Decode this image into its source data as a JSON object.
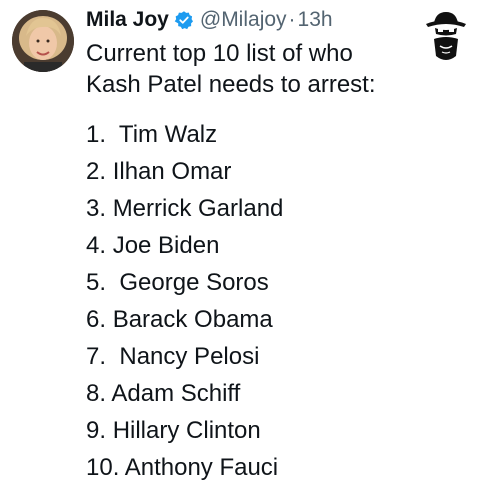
{
  "tweet": {
    "display_name": "Mila Joy",
    "handle": "@Milajoy",
    "separator": "·",
    "timestamp": "13h",
    "text_line_1": "Current top 10 list of who",
    "text_line_2": "Kash Patel needs to arrest:",
    "list": [
      {
        "num": "1.",
        "name": "Tim Walz",
        "gap": "  "
      },
      {
        "num": "2.",
        "name": "Ilhan Omar",
        "gap": " "
      },
      {
        "num": "3.",
        "name": "Merrick Garland",
        "gap": " "
      },
      {
        "num": "4.",
        "name": "Joe Biden",
        "gap": " "
      },
      {
        "num": "5.",
        "name": "George Soros",
        "gap": "  "
      },
      {
        "num": "6.",
        "name": "Barack Obama",
        "gap": " "
      },
      {
        "num": "7.",
        "name": "Nancy Pelosi",
        "gap": "  "
      },
      {
        "num": "8.",
        "name": "Adam Schiff",
        "gap": " "
      },
      {
        "num": "9.",
        "name": "Hillary Clinton",
        "gap": " "
      },
      {
        "num": "10.",
        "name": "Anthony Fauci",
        "gap": " "
      }
    ]
  },
  "icons": {
    "verified": "verified-badge-icon",
    "mask": "masked-bandit-icon"
  },
  "colors": {
    "text": "#0f1419",
    "secondary": "#536471",
    "verified": "#1d9bf0"
  }
}
